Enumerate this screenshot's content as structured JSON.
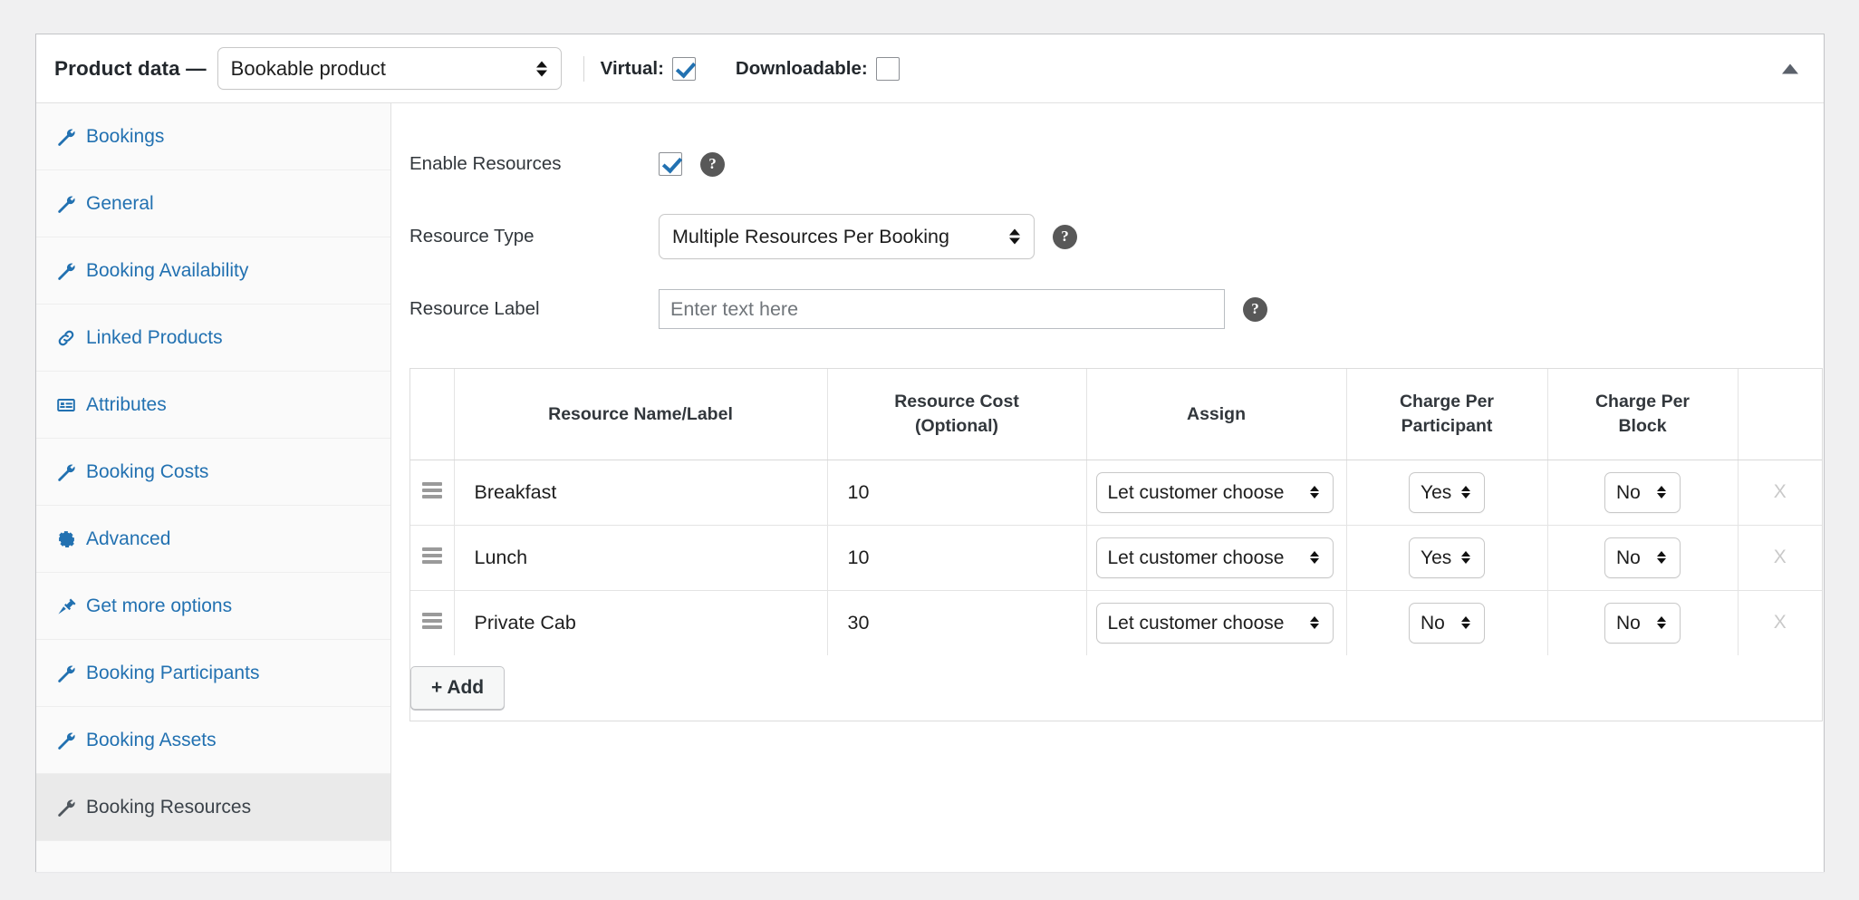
{
  "header": {
    "title": "Product data —",
    "product_type": "Bookable product",
    "product_type_options": [
      "Bookable product"
    ],
    "virtual_label": "Virtual:",
    "virtual_checked": true,
    "downloadable_label": "Downloadable:",
    "downloadable_checked": false,
    "collapse_icon": "triangle-up-icon"
  },
  "sidebar": {
    "items": [
      {
        "label": "Bookings",
        "icon": "wrench-icon",
        "active": false
      },
      {
        "label": "General",
        "icon": "wrench-icon",
        "active": false
      },
      {
        "label": "Booking Availability",
        "icon": "wrench-icon",
        "active": false
      },
      {
        "label": "Linked Products",
        "icon": "link-icon",
        "active": false
      },
      {
        "label": "Attributes",
        "icon": "list-icon",
        "active": false
      },
      {
        "label": "Booking Costs",
        "icon": "wrench-icon",
        "active": false
      },
      {
        "label": "Advanced",
        "icon": "gear-icon",
        "active": false
      },
      {
        "label": "Get more options",
        "icon": "plugin-icon",
        "active": false
      },
      {
        "label": "Booking Participants",
        "icon": "wrench-icon",
        "active": false
      },
      {
        "label": "Booking Assets",
        "icon": "wrench-icon",
        "active": false
      },
      {
        "label": "Booking Resources",
        "icon": "wrench-icon",
        "active": true
      }
    ]
  },
  "panel": {
    "enable_resources": {
      "label": "Enable Resources",
      "checked": true,
      "help": "?"
    },
    "resource_type": {
      "label": "Resource Type",
      "value": "Multiple Resources Per Booking",
      "options": [
        "Multiple Resources Per Booking"
      ],
      "help": "?"
    },
    "resource_label": {
      "label": "Resource Label",
      "value": "",
      "placeholder": "Enter text here",
      "help": "?"
    },
    "table": {
      "columns": [
        "",
        "Resource Name/Label",
        "Resource Cost (Optional)",
        "Assign",
        "Charge Per Participant",
        "Charge Per Block",
        ""
      ],
      "column_lines": {
        "cost_line1": "Resource Cost",
        "cost_line2": "(Optional)",
        "cpp_line1": "Charge Per",
        "cpp_line2": "Participant",
        "cpb_line1": "Charge Per",
        "cpb_line2": "Block"
      },
      "rows": [
        {
          "name": "Breakfast",
          "cost": "10",
          "assign": "Let customer choose",
          "charge_per_participant": "Yes",
          "charge_per_block": "No",
          "remove": "X"
        },
        {
          "name": "Lunch",
          "cost": "10",
          "assign": "Let customer choose",
          "charge_per_participant": "Yes",
          "charge_per_block": "No",
          "remove": "X"
        },
        {
          "name": "Private Cab",
          "cost": "30",
          "assign": "Let customer choose",
          "charge_per_participant": "No",
          "charge_per_block": "No",
          "remove": "X"
        }
      ],
      "assign_options": [
        "Let customer choose"
      ],
      "yesno_options": [
        "Yes",
        "No"
      ],
      "add_button": "+ Add"
    }
  },
  "colors": {
    "link": "#2271b1",
    "check_accent": "#2271b1",
    "active_bg": "#eaeaea",
    "sidebar_bg": "#fafafa",
    "page_bg": "#f0f0f1",
    "border": "#c3c4c7",
    "help_bubble": "#585858"
  }
}
